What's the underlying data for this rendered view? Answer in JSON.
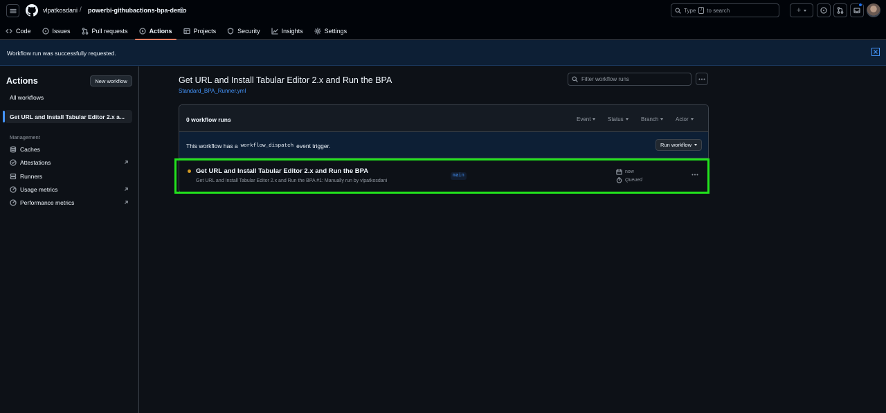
{
  "header": {
    "owner": "vlpatkosdani",
    "separator": "/",
    "repo": "powerbi-githubactions-bpa-demo",
    "search": {
      "before": "Type",
      "key": "/",
      "after": "to search"
    },
    "plus_label": "+"
  },
  "tabs": [
    {
      "label": "Code",
      "icon": "code-icon"
    },
    {
      "label": "Issues",
      "icon": "issue-icon"
    },
    {
      "label": "Pull requests",
      "icon": "pull-request-icon"
    },
    {
      "label": "Actions",
      "icon": "play-icon",
      "active": true
    },
    {
      "label": "Projects",
      "icon": "table-icon"
    },
    {
      "label": "Security",
      "icon": "shield-icon"
    },
    {
      "label": "Insights",
      "icon": "graph-icon"
    },
    {
      "label": "Settings",
      "icon": "gear-icon"
    }
  ],
  "flash": {
    "message": "Workflow run was successfully requested."
  },
  "sidebar": {
    "title": "Actions",
    "new_workflow": "New workflow",
    "all_workflows": "All workflows",
    "active_workflow": "Get URL and Install Tabular Editor 2.x a...",
    "management_heading": "Management",
    "items": [
      {
        "label": "Caches",
        "icon": "cache-icon"
      },
      {
        "label": "Attestations",
        "icon": "check-circle-icon"
      },
      {
        "label": "Runners",
        "icon": "server-icon"
      },
      {
        "label": "Usage metrics",
        "icon": "meter-icon"
      },
      {
        "label": "Performance metrics",
        "icon": "meter-icon"
      }
    ]
  },
  "workflow": {
    "title": "Get URL and Install Tabular Editor 2.x and Run the BPA",
    "file": "Standard_BPA_Runner.yml",
    "filter_placeholder": "Filter workflow runs",
    "runs_count": "0 workflow runs",
    "filters": [
      "Event",
      "Status",
      "Branch",
      "Actor"
    ],
    "dispatch": {
      "before": "This workflow has a",
      "code": "workflow_dispatch",
      "after": "event trigger."
    },
    "run_workflow": "Run workflow"
  },
  "run": {
    "title": "Get URL and Install Tabular Editor 2.x and Run the BPA",
    "subtitle": "Get URL and Install Tabular Editor 2.x and Run the BPA #1: Manually run by vlpatkosdani",
    "branch": "main",
    "time": "now",
    "status": "Queued",
    "status_color": "#d29922"
  },
  "colors": {
    "accent": "#4493f8",
    "highlight": "#22e41d",
    "tab_underline": "#f78166"
  }
}
